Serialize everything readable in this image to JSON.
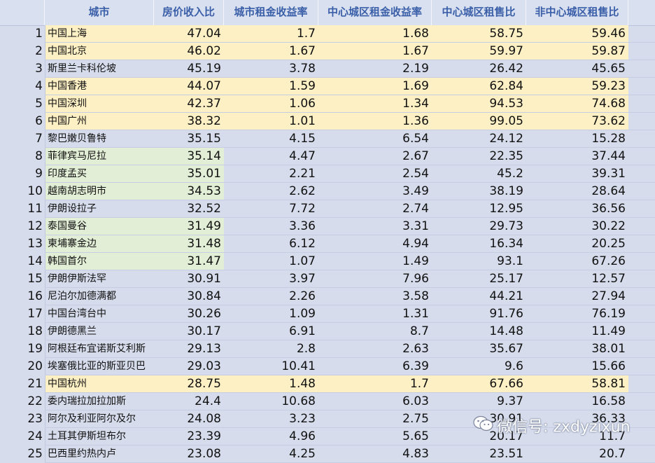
{
  "header": {
    "columns": [
      "城市",
      "房价收入比",
      "城市租金收益率",
      "中心城区租金收益率",
      "中心城区租售比",
      "非中心城区租售比"
    ]
  },
  "rows": [
    {
      "idx": "1",
      "city": "中国上海",
      "v": [
        "47.04",
        "1.7",
        "1.68",
        "58.75",
        "59.46"
      ],
      "hl": "yellow"
    },
    {
      "idx": "2",
      "city": "中国北京",
      "v": [
        "46.02",
        "1.67",
        "1.67",
        "59.97",
        "59.87"
      ],
      "hl": "yellow"
    },
    {
      "idx": "3",
      "city": "斯里兰卡科伦坡",
      "v": [
        "45.19",
        "3.78",
        "2.19",
        "26.42",
        "45.65"
      ],
      "hl": ""
    },
    {
      "idx": "4",
      "city": "中国香港",
      "v": [
        "44.07",
        "1.59",
        "1.69",
        "62.84",
        "59.23"
      ],
      "hl": "yellow"
    },
    {
      "idx": "5",
      "city": "中国深圳",
      "v": [
        "42.37",
        "1.06",
        "1.34",
        "94.53",
        "74.68"
      ],
      "hl": "yellow"
    },
    {
      "idx": "6",
      "city": "中国广州",
      "v": [
        "38.32",
        "1.01",
        "1.36",
        "99.05",
        "73.62"
      ],
      "hl": "yellow"
    },
    {
      "idx": "7",
      "city": "黎巴嫩贝鲁特",
      "v": [
        "35.15",
        "4.15",
        "6.54",
        "24.12",
        "15.28"
      ],
      "hl": ""
    },
    {
      "idx": "8",
      "city": "菲律宾马尼拉",
      "v": [
        "35.14",
        "4.47",
        "2.67",
        "22.35",
        "37.44"
      ],
      "hl": "green"
    },
    {
      "idx": "9",
      "city": "印度孟买",
      "v": [
        "35.01",
        "2.21",
        "2.54",
        "45.2",
        "39.31"
      ],
      "hl": "green"
    },
    {
      "idx": "10",
      "city": "越南胡志明市",
      "v": [
        "34.53",
        "2.62",
        "3.49",
        "38.19",
        "28.64"
      ],
      "hl": "green"
    },
    {
      "idx": "11",
      "city": "伊朗设拉子",
      "v": [
        "32.52",
        "7.72",
        "2.74",
        "12.95",
        "36.56"
      ],
      "hl": ""
    },
    {
      "idx": "12",
      "city": "泰国曼谷",
      "v": [
        "31.49",
        "3.36",
        "3.31",
        "29.73",
        "30.22"
      ],
      "hl": "green"
    },
    {
      "idx": "13",
      "city": "柬埔寨金边",
      "v": [
        "31.48",
        "6.12",
        "4.94",
        "16.34",
        "20.25"
      ],
      "hl": "green"
    },
    {
      "idx": "14",
      "city": "韩国首尔",
      "v": [
        "31.47",
        "1.07",
        "1.49",
        "93.1",
        "67.26"
      ],
      "hl": "green"
    },
    {
      "idx": "15",
      "city": "伊朗伊斯法罕",
      "v": [
        "30.91",
        "3.97",
        "7.96",
        "25.17",
        "12.57"
      ],
      "hl": ""
    },
    {
      "idx": "16",
      "city": "尼泊尔加德满都",
      "v": [
        "30.84",
        "2.26",
        "3.58",
        "44.21",
        "27.94"
      ],
      "hl": ""
    },
    {
      "idx": "17",
      "city": "中国台湾台中",
      "v": [
        "30.26",
        "1.09",
        "1.31",
        "91.76",
        "76.19"
      ],
      "hl": ""
    },
    {
      "idx": "18",
      "city": "伊朗德黑兰",
      "v": [
        "30.17",
        "6.91",
        "8.7",
        "14.48",
        "11.49"
      ],
      "hl": ""
    },
    {
      "idx": "19",
      "city": "阿根廷布宜诺斯艾利斯",
      "v": [
        "29.13",
        "2.8",
        "2.63",
        "35.67",
        "38.01"
      ],
      "hl": ""
    },
    {
      "idx": "20",
      "city": "埃塞俄比亚的斯亚贝巴",
      "v": [
        "29.03",
        "10.41",
        "6.39",
        "9.6",
        "15.66"
      ],
      "hl": ""
    },
    {
      "idx": "21",
      "city": "中国杭州",
      "v": [
        "28.75",
        "1.48",
        "1.7",
        "67.66",
        "58.81"
      ],
      "hl": "yellow"
    },
    {
      "idx": "22",
      "city": "委内瑞拉加拉加斯",
      "v": [
        "24.4",
        "10.68",
        "6.03",
        "9.37",
        "16.58"
      ],
      "hl": ""
    },
    {
      "idx": "23",
      "city": "阿尔及利亚阿尔及尔",
      "v": [
        "24.08",
        "3.23",
        "2.75",
        "30.91",
        "36.33"
      ],
      "hl": ""
    },
    {
      "idx": "24",
      "city": "土耳其伊斯坦布尔",
      "v": [
        "23.39",
        "4.96",
        "5.65",
        "20.17",
        "11.7"
      ],
      "hl": ""
    },
    {
      "idx": "25",
      "city": "巴西里约热内卢",
      "v": [
        "23.08",
        "4.25",
        "4.83",
        "23.51",
        "20.7"
      ],
      "hl": ""
    }
  ],
  "watermark": {
    "text": "微信号: zxdyzixun",
    "icon": "wechat-icon"
  },
  "colors": {
    "header_text": "#3a5fa8",
    "background": "#d6dcec",
    "highlight_yellow": "#fdf0c4",
    "highlight_green": "#e2eed6"
  }
}
